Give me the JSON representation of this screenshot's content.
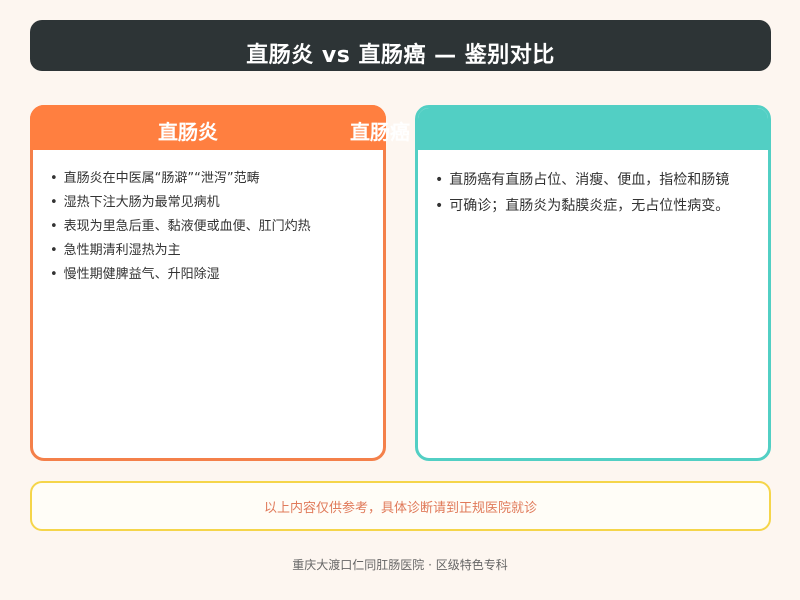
{
  "header": {
    "title": "直肠炎 vs 直肠癌 — 鉴别对比"
  },
  "left_panel": {
    "title": "直肠炎",
    "items": [
      "直肠炎在中医属“肠澼”“泄泻”范畴",
      "湿热下注大肠为最常见病机",
      "表现为里急后重、黏液便或血便、肛门灼热",
      "急性期清利湿热为主",
      "慢性期健脾益气、升阳除湿"
    ]
  },
  "right_panel": {
    "title": "直肠癌",
    "items": [
      "直肠癌有直肠占位、消瘦、便血，指检和肠镜",
      "可确诊；直肠炎为黏膜炎症，无占位性病变。"
    ]
  },
  "notice": {
    "text": "以上内容仅供参考，具体诊断请到正规医院就诊"
  },
  "footer": {
    "text": "重庆大渡口仁同肛肠医院 · 区级特色专科"
  },
  "colors": {
    "title_bg": "#2d3436",
    "left_accent": "#ff7f40",
    "right_accent": "#52cfc4",
    "notice_border": "#f5d54a",
    "notice_text": "#e07a5a",
    "page_bg": "#fdf6f0"
  }
}
